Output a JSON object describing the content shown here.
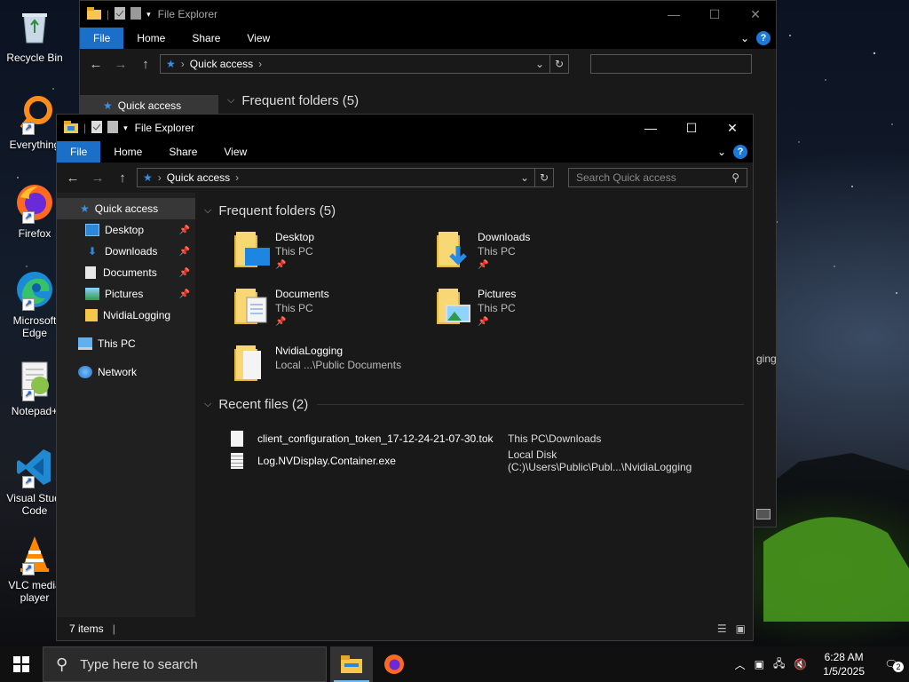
{
  "desktop": {
    "icons": [
      {
        "label": "Recycle Bin",
        "icon": "recycle-bin-icon"
      },
      {
        "label": "Everything",
        "icon": "everything-icon"
      },
      {
        "label": "Firefox",
        "icon": "firefox-icon"
      },
      {
        "label": "Microsoft Edge",
        "icon": "edge-icon"
      },
      {
        "label": "Notepad+",
        "icon": "notepadpp-icon"
      },
      {
        "label": "Visual Studi Code",
        "icon": "vscode-icon"
      },
      {
        "label": "VLC media player",
        "icon": "vlc-icon"
      }
    ]
  },
  "back_window": {
    "title": "File Explorer",
    "tabs": [
      "File",
      "Home",
      "Share",
      "View"
    ],
    "address": "Quick access",
    "nav_selected": "Quick access",
    "section": "Frequent folders (5)",
    "peek_text": "ging"
  },
  "front_window": {
    "title": "File Explorer",
    "tabs": [
      "File",
      "Home",
      "Share",
      "View"
    ],
    "address": "Quick access",
    "search_placeholder": "Search Quick access",
    "nav": {
      "quick_access": "Quick access",
      "pinned": [
        {
          "label": "Desktop",
          "icon": "desktop-folder-icon",
          "pinned": true
        },
        {
          "label": "Downloads",
          "icon": "downloads-icon",
          "pinned": true
        },
        {
          "label": "Documents",
          "icon": "documents-icon",
          "pinned": true
        },
        {
          "label": "Pictures",
          "icon": "pictures-icon",
          "pinned": true
        },
        {
          "label": "NvidiaLogging",
          "icon": "folder-icon",
          "pinned": false
        }
      ],
      "this_pc": "This PC",
      "network": "Network"
    },
    "frequent_header": "Frequent folders (5)",
    "frequent_folders": [
      {
        "name": "Desktop",
        "location": "This PC",
        "pinned": true,
        "icon": "desktop-folder-icon"
      },
      {
        "name": "Downloads",
        "location": "This PC",
        "pinned": true,
        "icon": "downloads-folder-icon"
      },
      {
        "name": "Documents",
        "location": "This PC",
        "pinned": true,
        "icon": "documents-folder-icon"
      },
      {
        "name": "Pictures",
        "location": "This PC",
        "pinned": true,
        "icon": "pictures-folder-icon"
      },
      {
        "name": "NvidiaLogging",
        "location": "Local ...\\Public Documents",
        "pinned": false,
        "icon": "folder-icon"
      }
    ],
    "recent_header": "Recent files (2)",
    "recent_files": [
      {
        "name": "client_configuration_token_17-12-24-21-07-30.tok",
        "location": "This PC\\Downloads"
      },
      {
        "name": "Log.NVDisplay.Container.exe",
        "location": "Local Disk (C:)\\Users\\Public\\Publ...\\NvidiaLogging"
      }
    ],
    "status": "7 items"
  },
  "taskbar": {
    "search_placeholder": "Type here to search",
    "time": "6:28 AM",
    "date": "1/5/2025",
    "notification_count": "2"
  },
  "colors": {
    "accent": "#1a6fc9",
    "window_bg": "#191919",
    "nav_bg": "#202020"
  }
}
